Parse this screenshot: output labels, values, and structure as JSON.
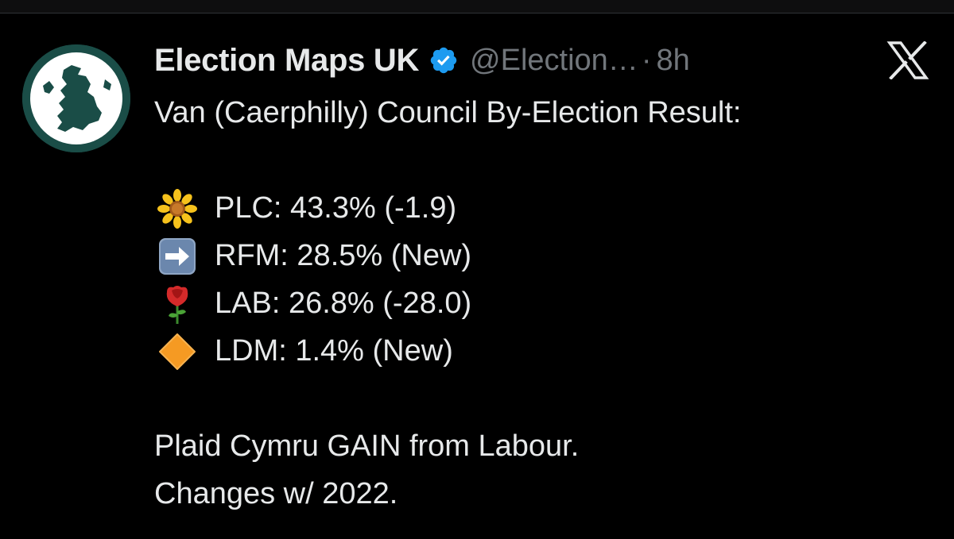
{
  "colors": {
    "background": "#000000",
    "text_primary": "#e7e9ea",
    "text_secondary": "#71767b",
    "verified_blue": "#1d9bf0",
    "avatar_bg": "#1a4d47"
  },
  "tweet": {
    "author": {
      "display_name": "Election Maps UK",
      "handle": "@Election…",
      "separator": "·",
      "time": "8h",
      "verified": true,
      "avatar_icon": "uk-map-logo-icon"
    },
    "platform_icon": "x-logo-icon",
    "lines": {
      "intro": "Van (Caerphilly) Council By-Election Result:",
      "results": [
        {
          "icon": "blossom-emoji-icon",
          "text": "PLC: 43.3% (-1.9)"
        },
        {
          "icon": "right-arrow-emoji-icon",
          "text": "RFM: 28.5% (New)"
        },
        {
          "icon": "rose-emoji-icon",
          "text": "LAB: 26.8% (-28.0)"
        },
        {
          "icon": "orange-diamond-emoji-icon",
          "text": "LDM: 1.4% (New)"
        }
      ],
      "summary": "Plaid Cymru GAIN from Labour.",
      "changes_note": "Changes w/ 2022."
    }
  }
}
